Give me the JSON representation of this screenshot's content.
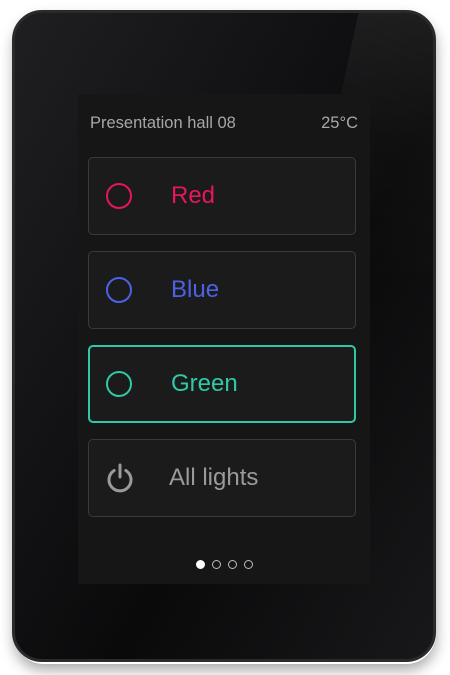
{
  "header": {
    "room_name": "Presentation hall 08",
    "temperature": "25°C"
  },
  "buttons": [
    {
      "label": "Red",
      "color": "#e5175a",
      "icon": "circle-ring-icon",
      "active": false
    },
    {
      "label": "Blue",
      "color": "#4a63e6",
      "icon": "circle-ring-icon",
      "active": false
    },
    {
      "label": "Green",
      "color": "#2fc9a8",
      "icon": "circle-ring-icon",
      "active": true
    },
    {
      "label": "All lights",
      "color": "#9a9a9a",
      "icon": "power-icon",
      "active": false
    }
  ],
  "pagination": {
    "total_pages": 4,
    "current_page": 1
  },
  "colors": {
    "screen_background": "#161616",
    "active_border": "#2fc9a8",
    "header_text": "#a7a7a7"
  }
}
